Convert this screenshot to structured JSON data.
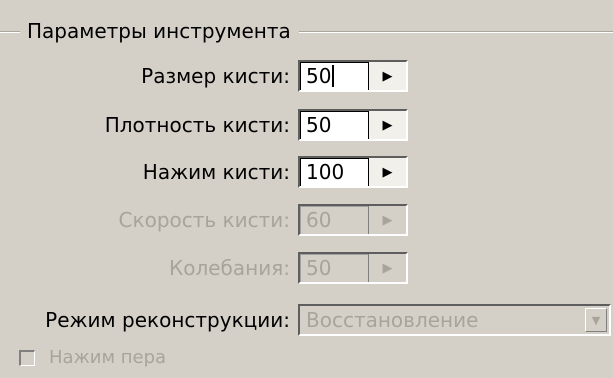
{
  "group_title": "Параметры инструмента",
  "rows": [
    {
      "label": "Размер кисти:",
      "value": "50",
      "enabled": true,
      "focused": true
    },
    {
      "label": "Плотность кисти:",
      "value": "50",
      "enabled": true,
      "focused": false
    },
    {
      "label": "Нажим кисти:",
      "value": "100",
      "enabled": true,
      "focused": false
    },
    {
      "label": "Скорость кисти:",
      "value": "60",
      "enabled": false,
      "focused": false
    },
    {
      "label": "Колебания:",
      "value": "50",
      "enabled": false,
      "focused": false
    }
  ],
  "reconstruction": {
    "label": "Режим реконструкции:",
    "value": "Восстановление",
    "enabled": false
  },
  "pen_pressure": {
    "label": "Нажим пера",
    "checked": false,
    "enabled": false
  },
  "icons": {
    "spin": "right-arrow-icon",
    "dropdown": "down-arrow-icon"
  }
}
